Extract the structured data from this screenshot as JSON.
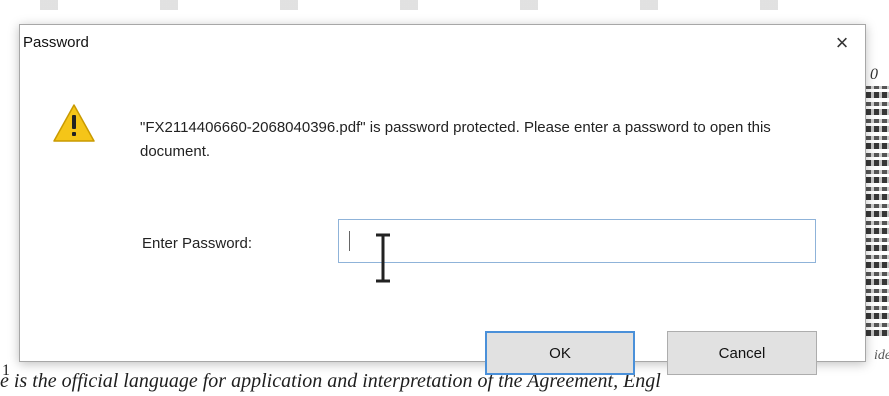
{
  "dialog": {
    "title": "Password",
    "close_glyph": "×",
    "icon": "warning-icon",
    "message": "\"FX2114406660-2068040396.pdf\" is password protected. Please enter a password to open this document.",
    "password_label": "Enter Password:",
    "password_value": "",
    "ok_label": "OK",
    "cancel_label": "Cancel"
  },
  "background_document": {
    "left_mark_top": "'",
    "left_mark_bottom": "1",
    "right_fragment": "0",
    "right_small_fragment": "ide",
    "line_text": "e is the official language for application and interpretation of the Agreement, Engl"
  },
  "colors": {
    "dialog_bg": "#ffffff",
    "input_border": "#8fb3d9",
    "ok_border": "#4a90d9",
    "warning_fill": "#f5c518"
  }
}
